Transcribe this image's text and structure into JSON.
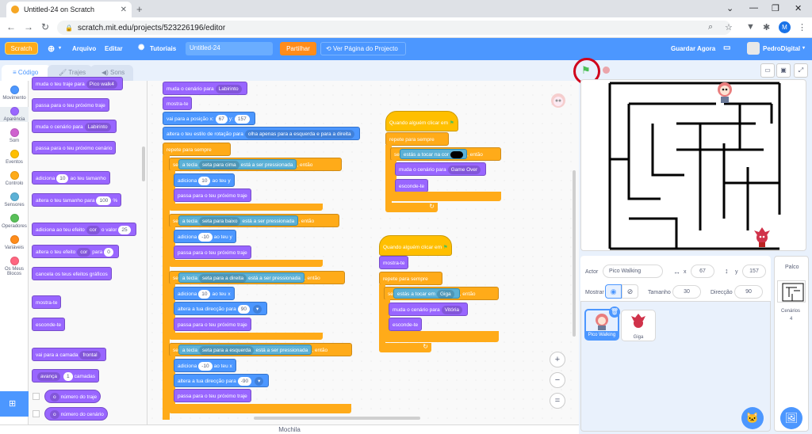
{
  "browser": {
    "tab_title": "Untitled-24 on Scratch",
    "new_tab": "+",
    "url": "scratch.mit.edu/projects/523226196/editor",
    "profile_initial": "M"
  },
  "menubar": {
    "logo": "Scratch",
    "language_icon": "globe-icon",
    "file": "Arquivo",
    "edit": "Editar",
    "tutorials": "Tutoriais",
    "project_title": "Untitled-24",
    "share": "Partilhar",
    "see_project": "Ver Página do Projecto",
    "save_now": "Guardar Agora",
    "username": "PedroDigital"
  },
  "editor_tabs": {
    "code": "Código",
    "costumes": "Trajes",
    "sounds": "Sons"
  },
  "categories": [
    {
      "label": "Movimento",
      "color": "#4c97ff"
    },
    {
      "label": "Aparência",
      "color": "#9966ff"
    },
    {
      "label": "Som",
      "color": "#cf63cf"
    },
    {
      "label": "Eventos",
      "color": "#ffbf00"
    },
    {
      "label": "Controlo",
      "color": "#ffab19"
    },
    {
      "label": "Sensores",
      "color": "#5cb1d6"
    },
    {
      "label": "Operadores",
      "color": "#59c059"
    },
    {
      "label": "Variáveis",
      "color": "#ff8c1a"
    },
    {
      "label": "Os Meus Blocos",
      "color": "#ff6680"
    }
  ],
  "palette": {
    "b0": "muda o teu traje para",
    "b0_dd": "Pico walk4",
    "b1": "passa para o teu próximo traje",
    "b2": "muda o cenário para",
    "b2_dd": "Labirinto",
    "b3": "passa para o teu próximo cenário",
    "b4a": "adiciona",
    "b4_val": "10",
    "b4b": "ao teu tamanho",
    "b5": "altera o teu tamanho para",
    "b5_val": "100",
    "b5_pct": "%",
    "b6a": "adiciona ao teu efeito",
    "b6_dd": "cor",
    "b6b": "o valor",
    "b6_val": "25",
    "b7a": "altera o teu efeito",
    "b7_dd": "cor",
    "b7b": "para",
    "b7_val": "0",
    "b8": "cancela os teus efeitos gráficos",
    "b9": "mostra-te",
    "b10": "esconde-te",
    "b11": "vai para a camada",
    "b11_dd": "frontal",
    "b12_dd": "avança",
    "b12_val": "1",
    "b12b": "camadas",
    "b13_dd": "o",
    "b13b": "número",
    "b13c": "do traje",
    "b14_dd": "o",
    "b14b": "número",
    "b14c": "do cenário"
  },
  "script1": {
    "s0": "muda o cenário para",
    "s0_dd": "Labirinto",
    "s1": "mostra-te",
    "s2a": "vai para a posição x:",
    "s2_x": "67",
    "s2b": "y:",
    "s2_y": "157",
    "s3a": "altera o teu estilo de rotação para",
    "s3_dd": "olha apenas para a esquerda e para a direita",
    "s4": "repete para sempre",
    "if": "se",
    "then": ", então",
    "key_a": "a tecla",
    "pressed": "está a ser pressionada",
    "k1": "seta para cima",
    "k2": "seta para baixo",
    "k3": "seta para a direita",
    "k4": "seta para a esquerda",
    "add": "adiciona",
    "to_y": "ao teu y",
    "to_x": "ao teu x",
    "v1": "10",
    "v2": "-10",
    "v3": "10",
    "v4": "-10",
    "next": "passa para o teu próximo traje",
    "dir": "altera a tua direcção para",
    "d3": "90",
    "d4": "-90"
  },
  "script2": {
    "hat": "Quando alguém clicar em",
    "loop": "repete para sempre",
    "if": "se",
    "touch": "estás a tocar na cor",
    "then": ", então",
    "b1": "muda o cenário para",
    "b1_dd": "Game Over",
    "b2": "esconde-te"
  },
  "script3": {
    "hat": "Quando alguém clicar em",
    "b0": "mostra-te",
    "loop": "repete para sempre",
    "if": "se",
    "touch": "estás a tocar em",
    "touch_dd": "Giga",
    "then": ", então",
    "b1": "muda o cenário para",
    "b1_dd": "Vitória",
    "b2": "esconde-te"
  },
  "zoom": {
    "in": "+",
    "out": "−",
    "reset": "="
  },
  "backpack": "Mochila",
  "sprite_info": {
    "sprite_label": "Actor",
    "sprite_name": "Pico Walking",
    "x_label": "x",
    "x": "67",
    "y_label": "y",
    "y": "157",
    "show_label": "Mostrar",
    "size_label": "Tamanho",
    "size": "30",
    "dir_label": "Direcção",
    "direction": "90"
  },
  "sprites": [
    {
      "name": "Pico Walking"
    },
    {
      "name": "Giga"
    }
  ],
  "stage_panel": {
    "title": "Palco",
    "backdrops_label": "Cenários",
    "backdrops_count": "4"
  }
}
